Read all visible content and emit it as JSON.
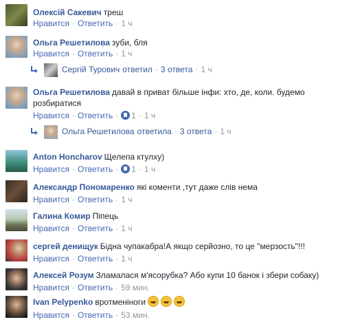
{
  "labels": {
    "like": "Нравится",
    "reply": "Ответить",
    "dot": "·"
  },
  "comments": [
    {
      "author": "Олексій Сакевич",
      "text": "треш",
      "time": "1 ч"
    },
    {
      "author": "Ольга Решетилова",
      "text": "зуби, бля",
      "time": "1 ч",
      "replies": {
        "replier": "Сергій Турович",
        "verb": "ответил",
        "count": "3 ответа",
        "time": "1 ч"
      }
    },
    {
      "author": "Ольга Решетилова",
      "text": "давай в приват більше інфи: хто, де, коли. будемо розбиратися",
      "time": "1 ч",
      "likes": "1",
      "replies": {
        "replier": "Ольга Решетилова",
        "verb": "ответила",
        "count": "3 ответа",
        "time": "1 ч"
      }
    },
    {
      "author": "Anton Honcharov",
      "text": "Щелепа ктулху)",
      "time": "1 ч",
      "likes": "1"
    },
    {
      "author": "Александр Пономаренко",
      "text": "які коменти ,тут даже слів нема",
      "time": "1 ч"
    },
    {
      "author": "Галина Комир",
      "text": "Піпець",
      "time": "1 ч"
    },
    {
      "author": "сергей денищук",
      "text": "Бідна чупакабра!А якщо серйозно, то це \"мерзость\"!!!",
      "time": "1 ч"
    },
    {
      "author": "Алексей Розум",
      "text": "Зламалася м'ясорубка? Або купи 10 банок і збери собаку)",
      "time": "59 мин."
    },
    {
      "author": "Ivan Pelypenko",
      "text": "вротменіноги",
      "time": "53 мин.",
      "emoji": "grin-sweat-emoji"
    }
  ],
  "colors": {
    "link": "#365899",
    "action": "#4267b2",
    "meta": "#90949c",
    "text": "#1d2129"
  }
}
